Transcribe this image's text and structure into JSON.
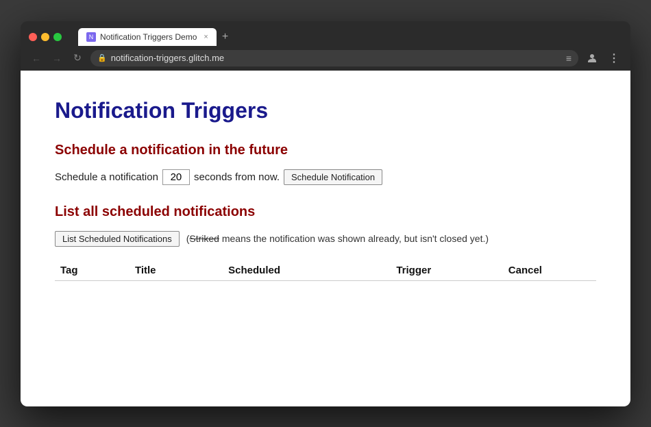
{
  "browser": {
    "tab": {
      "favicon_label": "N",
      "title": "Notification Triggers Demo",
      "close_label": "×"
    },
    "new_tab_label": "+",
    "nav": {
      "back": "←",
      "forward": "→",
      "reload": "↻"
    },
    "url": "notification-triggers.glitch.me",
    "lock_icon": "🔒",
    "menu_icon": "≡",
    "profile_icon": "👤",
    "more_icon": "⋮"
  },
  "page": {
    "title": "Notification Triggers",
    "schedule_section": {
      "heading": "Schedule a notification in the future",
      "label_before": "Schedule a notification",
      "input_value": "20",
      "label_after": "seconds from now.",
      "button_label": "Schedule Notification"
    },
    "list_section": {
      "heading": "List all scheduled notifications",
      "button_label": "List Scheduled Notifications",
      "note_plain": "(",
      "note_struck": "Striked",
      "note_rest": " means the notification was shown already, but isn't closed yet.)",
      "table": {
        "columns": [
          "Tag",
          "Title",
          "Scheduled",
          "Trigger",
          "Cancel"
        ],
        "rows": []
      }
    }
  }
}
